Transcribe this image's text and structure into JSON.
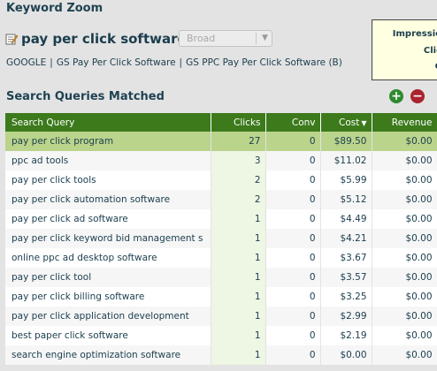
{
  "panel": {
    "title": "Keyword Zoom"
  },
  "keyword": {
    "text": "pay per click software",
    "match_type": "Broad",
    "breadcrumb": [
      "GOOGLE",
      "GS Pay Per Click Software",
      "GS PPC Pay Per Click Software (B)"
    ],
    "breadcrumb_separator": "|"
  },
  "stats": [
    "Impressio",
    "Clic",
    "C"
  ],
  "section": {
    "title": "Search Queries Matched"
  },
  "table": {
    "columns": {
      "query": "Search Query",
      "clicks": "Clicks",
      "conv": "Conv",
      "cost": "Cost",
      "revenue": "Revenue"
    },
    "sorted_by": "Cost",
    "sort_direction": "descending",
    "rows": [
      {
        "query": "pay per click program",
        "clicks": "27",
        "conv": "0",
        "cost": "$89.50",
        "revenue": "$0.00"
      },
      {
        "query": "ppc ad tools",
        "clicks": "3",
        "conv": "0",
        "cost": "$11.02",
        "revenue": "$0.00"
      },
      {
        "query": "pay per click tools",
        "clicks": "2",
        "conv": "0",
        "cost": "$5.99",
        "revenue": "$0.00"
      },
      {
        "query": "pay per click automation software",
        "clicks": "2",
        "conv": "0",
        "cost": "$5.12",
        "revenue": "$0.00"
      },
      {
        "query": "pay per click ad software",
        "clicks": "1",
        "conv": "0",
        "cost": "$4.49",
        "revenue": "$0.00"
      },
      {
        "query": "pay per click keyword bid management s",
        "clicks": "1",
        "conv": "0",
        "cost": "$4.21",
        "revenue": "$0.00"
      },
      {
        "query": "online ppc ad desktop software",
        "clicks": "1",
        "conv": "0",
        "cost": "$3.67",
        "revenue": "$0.00"
      },
      {
        "query": "pay per click tool",
        "clicks": "1",
        "conv": "0",
        "cost": "$3.57",
        "revenue": "$0.00"
      },
      {
        "query": "pay per click billing software",
        "clicks": "1",
        "conv": "0",
        "cost": "$3.25",
        "revenue": "$0.00"
      },
      {
        "query": "pay per click application development",
        "clicks": "1",
        "conv": "0",
        "cost": "$2.99",
        "revenue": "$0.00"
      },
      {
        "query": "best paper click software",
        "clicks": "1",
        "conv": "0",
        "cost": "$2.19",
        "revenue": "$0.00"
      },
      {
        "query": "search engine optimization software",
        "clicks": "1",
        "conv": "0",
        "cost": "$0.00",
        "revenue": "$0.00"
      }
    ],
    "selected_row": 0
  },
  "colors": {
    "header_green": "#3c7a1c",
    "selected_row": "#bad48c",
    "add_button": "#2f8a2f",
    "remove_button": "#a9242e",
    "stats_background": "#ffffe1"
  },
  "icons": {
    "keyword": "edit-note-icon",
    "add": "plus-icon",
    "remove": "minus-icon",
    "sort": "sort-desc-icon"
  }
}
